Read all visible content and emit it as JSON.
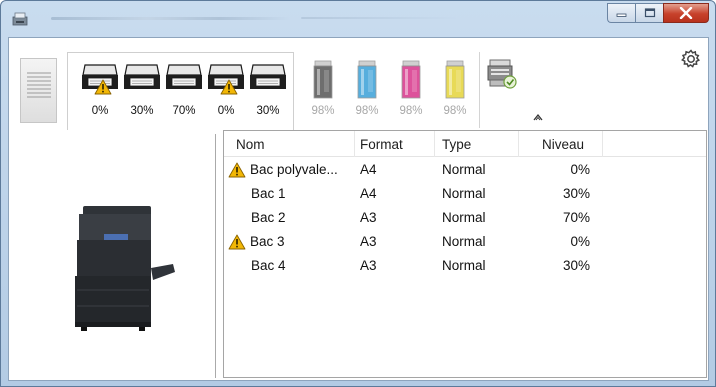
{
  "window": {
    "controls": {
      "minimize": "minimize-icon",
      "maximize": "maximize-icon",
      "close": "close-icon"
    }
  },
  "toolbar": {
    "trays": [
      {
        "percent": "0%",
        "warning": true
      },
      {
        "percent": "30%",
        "warning": false
      },
      {
        "percent": "70%",
        "warning": false
      },
      {
        "percent": "0%",
        "warning": true
      },
      {
        "percent": "30%",
        "warning": false
      }
    ],
    "toners": [
      {
        "percent": "98%",
        "color": "#555555"
      },
      {
        "percent": "98%",
        "color": "#3aa0d8"
      },
      {
        "percent": "98%",
        "color": "#d8348a"
      },
      {
        "percent": "98%",
        "color": "#e4d43a"
      }
    ]
  },
  "table": {
    "headers": {
      "nom": "Nom",
      "format": "Format",
      "type": "Type",
      "niveau": "Niveau"
    },
    "rows": [
      {
        "nom": "Bac polyvale...",
        "format": "A4",
        "type": "Normal",
        "niveau": "0%",
        "warning": true
      },
      {
        "nom": "Bac 1",
        "format": "A4",
        "type": "Normal",
        "niveau": "30%",
        "warning": false
      },
      {
        "nom": "Bac 2",
        "format": "A3",
        "type": "Normal",
        "niveau": "70%",
        "warning": false
      },
      {
        "nom": "Bac 3",
        "format": "A3",
        "type": "Normal",
        "niveau": "0%",
        "warning": true
      },
      {
        "nom": "Bac 4",
        "format": "A3",
        "type": "Normal",
        "niveau": "30%",
        "warning": false
      }
    ]
  },
  "colors": {
    "warning": "#f2b705",
    "titlebar": "#c2d6ec",
    "close_button": "#c7412b"
  }
}
